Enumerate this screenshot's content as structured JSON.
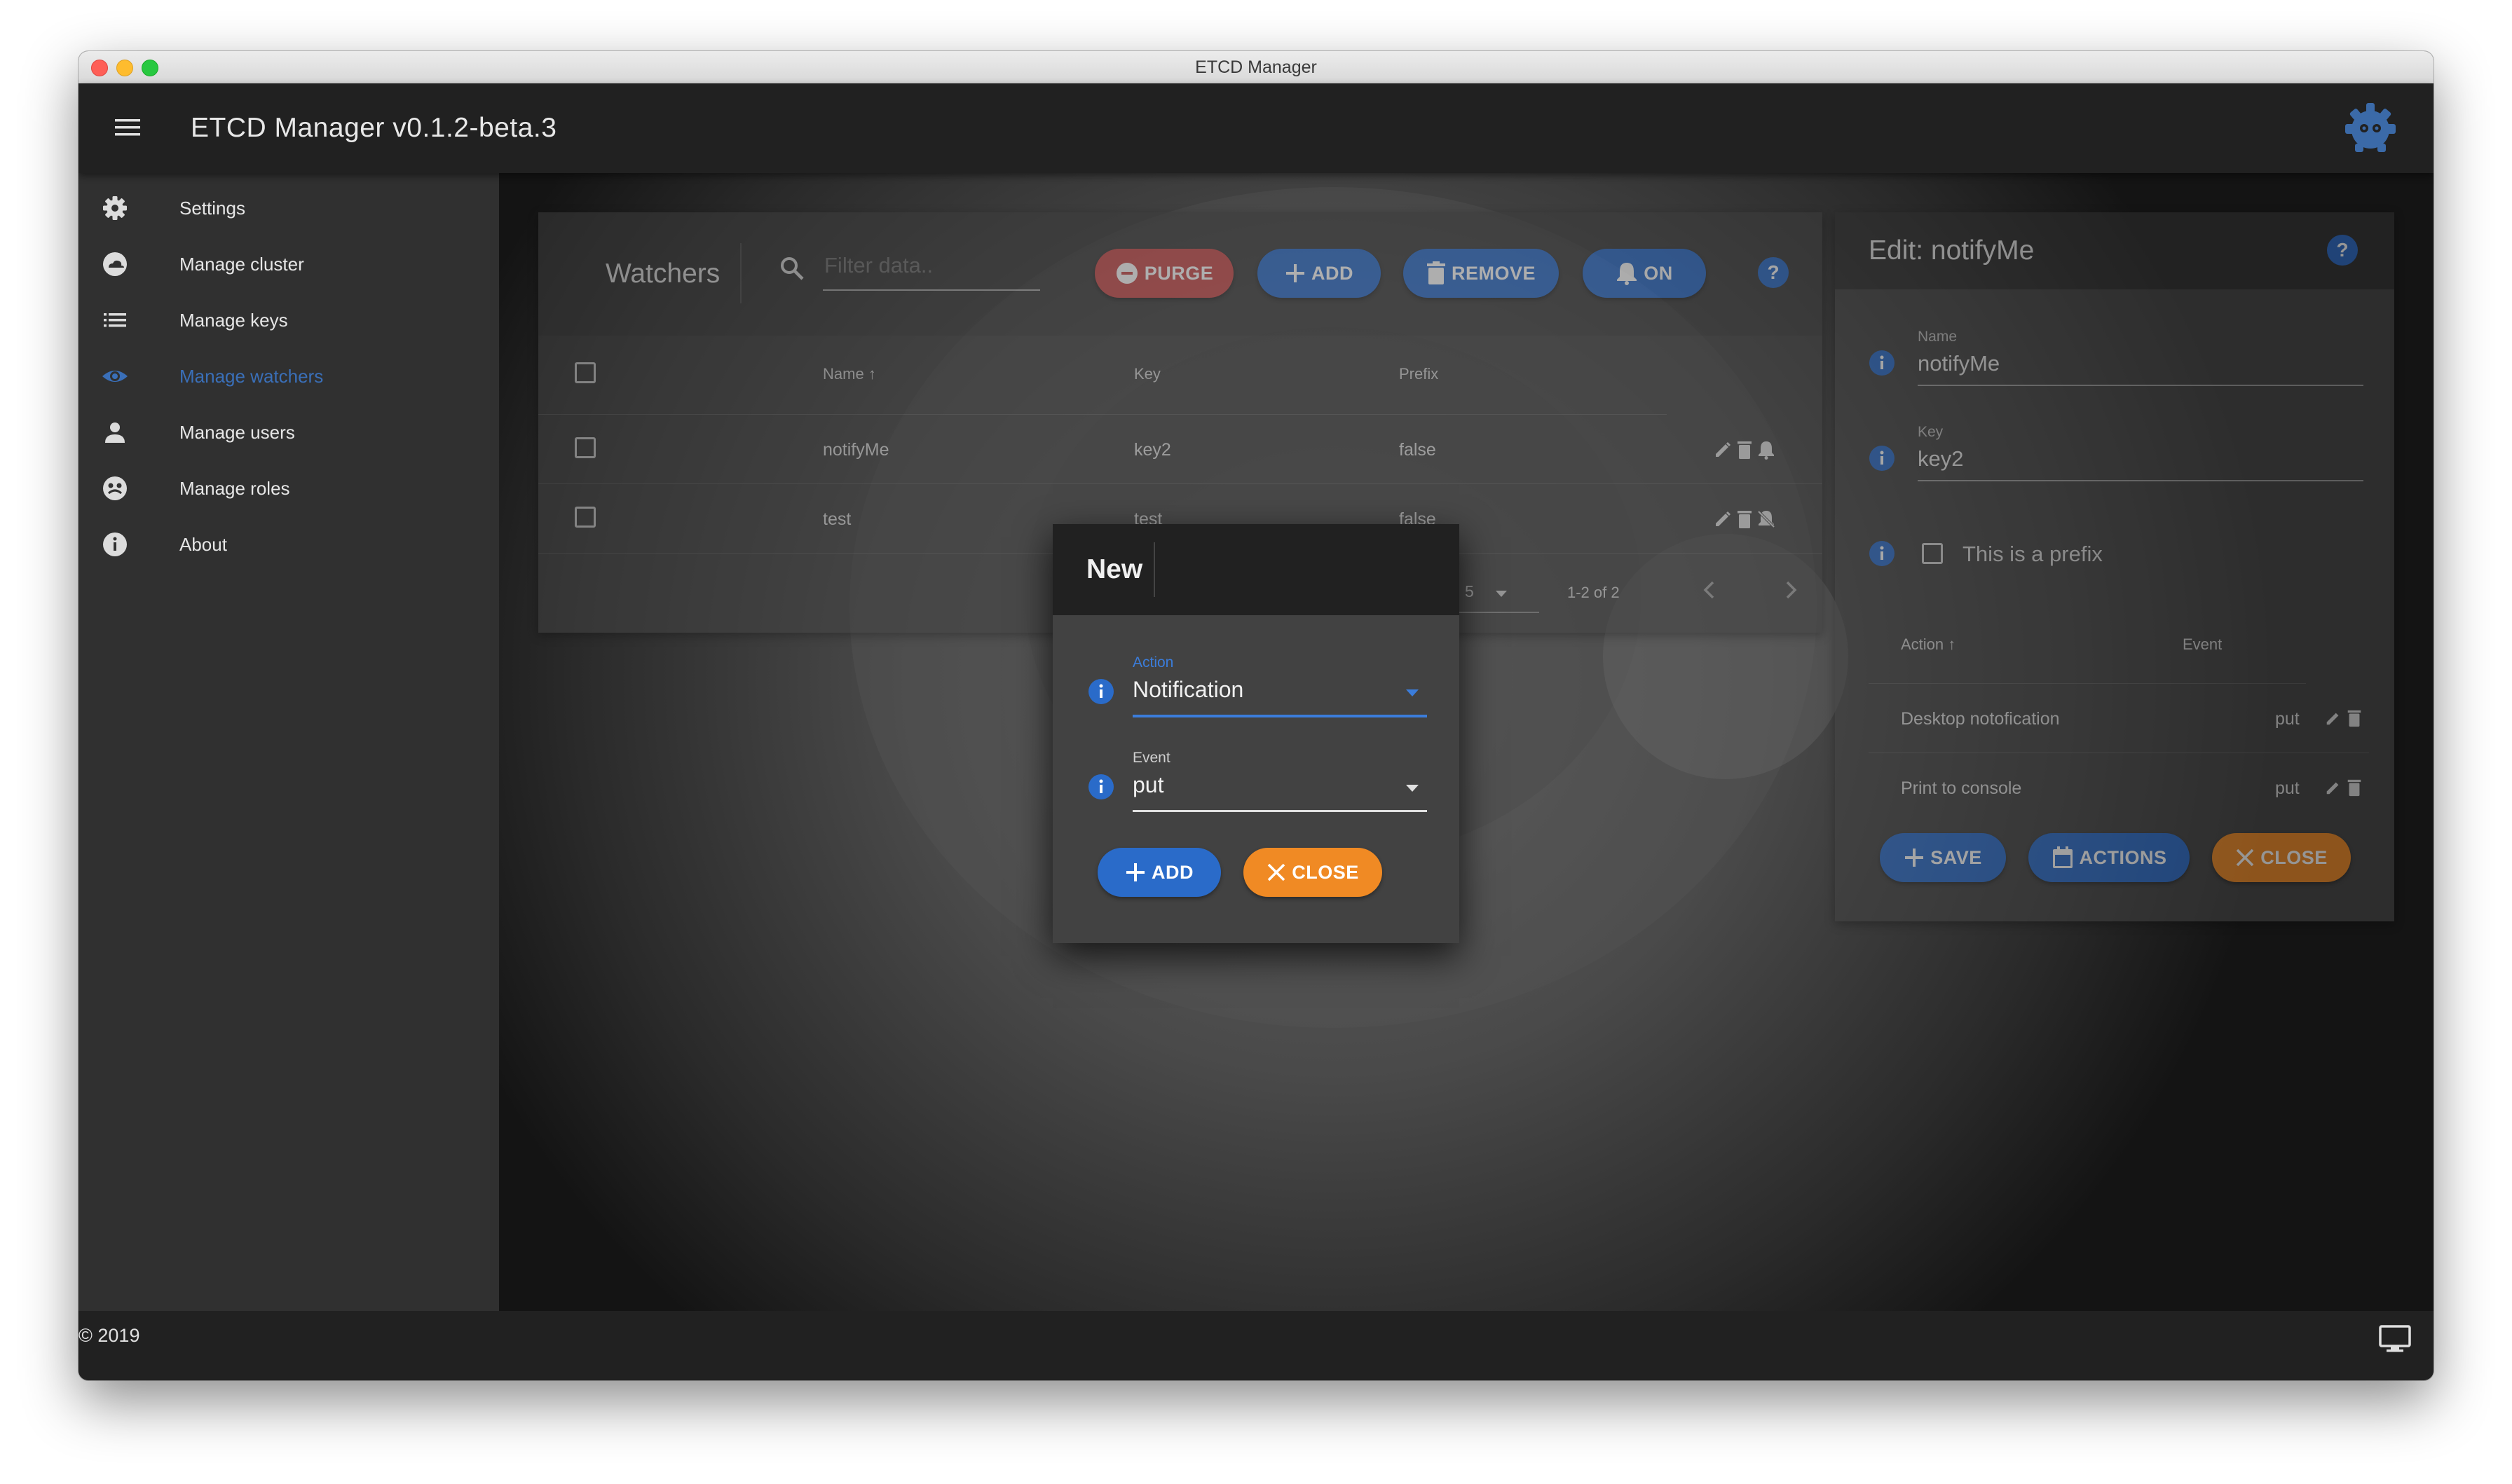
{
  "window": {
    "title": "ETCD Manager",
    "app_title": "ETCD Manager v0.1.2-beta.3",
    "footer": "© 2019"
  },
  "colors": {
    "accent_blue": "#2a6bc9",
    "purge_red": "#c84a4a",
    "close_orange": "#f08a24",
    "active_nav": "#3a6fb8"
  },
  "sidebar": {
    "items": [
      {
        "label": "Settings",
        "icon": "gear-icon"
      },
      {
        "label": "Manage cluster",
        "icon": "cloud-icon"
      },
      {
        "label": "Manage keys",
        "icon": "list-icon"
      },
      {
        "label": "Manage watchers",
        "icon": "eye-icon",
        "active": true
      },
      {
        "label": "Manage users",
        "icon": "person-icon"
      },
      {
        "label": "Manage roles",
        "icon": "roles-icon"
      },
      {
        "label": "About",
        "icon": "info-icon"
      }
    ]
  },
  "watchers": {
    "title": "Watchers",
    "filter_placeholder": "Filter data..",
    "buttons": {
      "purge": "PURGE",
      "add": "ADD",
      "remove": "REMOVE",
      "on": "ON"
    },
    "columns": {
      "name": "Name",
      "key": "Key",
      "prefix": "Prefix"
    },
    "rows": [
      {
        "name": "notifyMe",
        "key": "key2",
        "prefix": "false"
      },
      {
        "name": "test",
        "key": "test",
        "prefix": "false"
      }
    ],
    "pagination": {
      "per_page": "5",
      "range": "1-2 of 2"
    }
  },
  "edit": {
    "title": "Edit: notifyMe",
    "name_label": "Name",
    "name_value": "notifyMe",
    "key_label": "Key",
    "key_value": "key2",
    "prefix_label": "This is a prefix",
    "columns": {
      "action": "Action",
      "event": "Event"
    },
    "rows": [
      {
        "action": "Desktop notofication",
        "event": "put"
      },
      {
        "action": "Print to console",
        "event": "put"
      }
    ],
    "buttons": {
      "save": "SAVE",
      "actions": "ACTIONS",
      "close": "CLOSE"
    }
  },
  "dialog": {
    "title": "New",
    "action_label": "Action",
    "action_value": "Notification",
    "event_label": "Event",
    "event_value": "put",
    "add": "ADD",
    "close": "CLOSE"
  }
}
